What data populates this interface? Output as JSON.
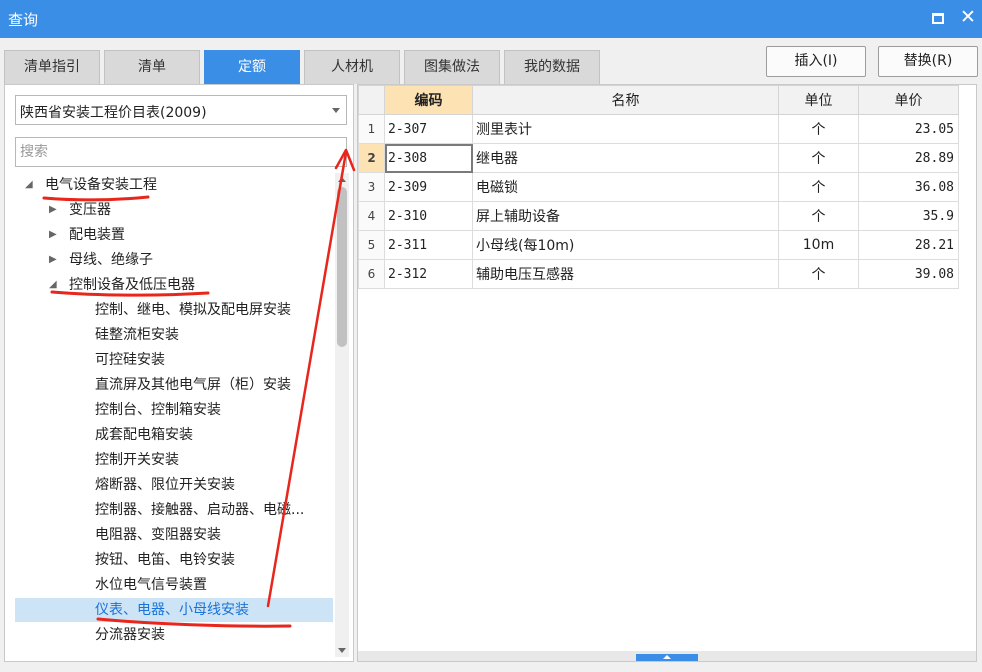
{
  "window": {
    "title": "查询"
  },
  "tabs": [
    {
      "label": "清单指引"
    },
    {
      "label": "清单"
    },
    {
      "label": "定额",
      "active": true
    },
    {
      "label": "人材机"
    },
    {
      "label": "图集做法"
    },
    {
      "label": "我的数据"
    }
  ],
  "actions": {
    "insert": "插入(I)",
    "replace": "替换(R)"
  },
  "left": {
    "library": "陕西省安装工程价目表(2009)",
    "search_placeholder": "搜索",
    "tree": [
      {
        "label": "电气设备安装工程",
        "level": 0,
        "expanded": true
      },
      {
        "label": "变压器",
        "level": 1,
        "expanded": false
      },
      {
        "label": "配电装置",
        "level": 1,
        "expanded": false
      },
      {
        "label": "母线、绝缘子",
        "level": 1,
        "expanded": false
      },
      {
        "label": "控制设备及低压电器",
        "level": 1,
        "expanded": true
      },
      {
        "label": "控制、继电、模拟及配电屏安装",
        "level": 2
      },
      {
        "label": "硅整流柜安装",
        "level": 2
      },
      {
        "label": "可控硅安装",
        "level": 2
      },
      {
        "label": "直流屏及其他电气屏（柜）安装",
        "level": 2
      },
      {
        "label": "控制台、控制箱安装",
        "level": 2
      },
      {
        "label": "成套配电箱安装",
        "level": 2
      },
      {
        "label": "控制开关安装",
        "level": 2
      },
      {
        "label": "熔断器、限位开关安装",
        "level": 2
      },
      {
        "label": "控制器、接触器、启动器、电磁...",
        "level": 2
      },
      {
        "label": "电阻器、变阻器安装",
        "level": 2
      },
      {
        "label": "按钮、电笛、电铃安装",
        "level": 2
      },
      {
        "label": "水位电气信号装置",
        "level": 2
      },
      {
        "label": "仪表、电器、小母线安装",
        "level": 2,
        "selected": true
      },
      {
        "label": "分流器安装",
        "level": 2
      },
      {
        "label": "",
        "level": 2
      }
    ]
  },
  "table": {
    "columns": [
      "",
      "编码",
      "名称",
      "单位",
      "单价"
    ],
    "rows": [
      {
        "no": "1",
        "code": "2-307",
        "name": "测里表计",
        "unit": "个",
        "price": "23.05"
      },
      {
        "no": "2",
        "code": "2-308",
        "name": "继电器",
        "unit": "个",
        "price": "28.89",
        "current": true
      },
      {
        "no": "3",
        "code": "2-309",
        "name": "电磁锁",
        "unit": "个",
        "price": "36.08"
      },
      {
        "no": "4",
        "code": "2-310",
        "name": "屏上辅助设备",
        "unit": "个",
        "price": "35.9"
      },
      {
        "no": "5",
        "code": "2-311",
        "name": "小母线(每10m)",
        "unit": "10m",
        "price": "28.21"
      },
      {
        "no": "6",
        "code": "2-312",
        "name": "辅助电压互感器",
        "unit": "个",
        "price": "39.08"
      }
    ]
  },
  "colors": {
    "accent": "#3a8ee6",
    "header_highlight": "#fde3b4",
    "selection": "#cde4f7",
    "annotation": "#e8261c"
  }
}
